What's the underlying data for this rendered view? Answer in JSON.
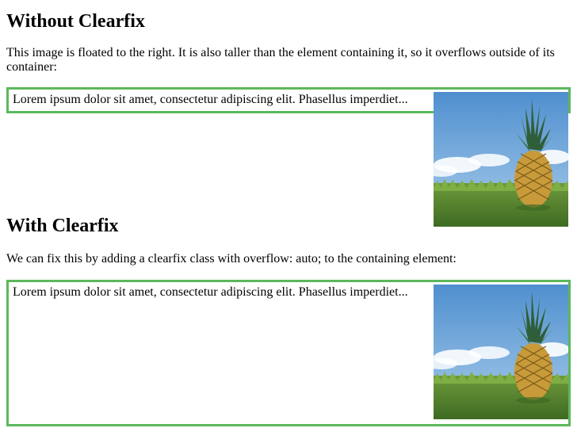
{
  "section1": {
    "title": "Without Clearfix",
    "description": "This image is floated to the right. It is also taller than the element containing it, so it overflows outside of its container:",
    "box_text": "Lorem ipsum dolor sit amet, consectetur adipiscing elit. Phasellus imperdiet..."
  },
  "section2": {
    "title": "With Clearfix",
    "description": "We can fix this by adding a clearfix class with overflow: auto; to the containing element:",
    "box_text": "Lorem ipsum dolor sit amet, consectetur adipiscing elit. Phasellus imperdiet..."
  },
  "colors": {
    "border": "#5cb85c",
    "sky": "#6aa3d6",
    "grass": "#4d7a2c"
  }
}
